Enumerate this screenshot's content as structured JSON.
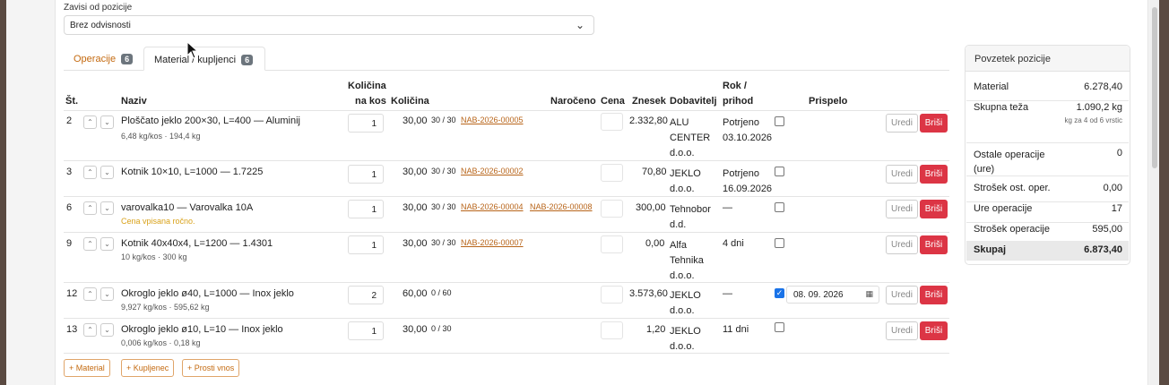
{
  "dependency": {
    "label": "Zavisi od pozicije",
    "value": "Brez odvisnosti"
  },
  "tabs": [
    {
      "label": "Operacije",
      "count": "6"
    },
    {
      "label": "Material / kupljenci",
      "count": "6"
    }
  ],
  "headers": {
    "st": "Št.",
    "naziv": "Naziv",
    "kol_na_kos_1": "Količina",
    "kol_na_kos_2": "na kos",
    "kolicina": "Količina",
    "naroceno": "Naročeno",
    "cena": "Cena",
    "znesek": "Znesek",
    "dobavitelj": "Dobavitelj",
    "rok_1": "Rok /",
    "rok_2": "prihod",
    "prispelo": "Prispelo"
  },
  "rows": [
    {
      "st": "2",
      "name": "Ploščato jeklo 200×30, L=400 — Aluminij",
      "sub": "6,48 kg/kos · 194,4 kg",
      "qty": "1",
      "kolicina": "30,00",
      "ordered": "30 / 30",
      "links": [
        "NAB-2026-00005"
      ],
      "znesek": "2.332,80",
      "dob": [
        "ALU",
        "CENTER",
        "d.o.o."
      ],
      "rok": [
        "Potrjeno",
        "03.10.2026"
      ],
      "checked": false
    },
    {
      "st": "3",
      "name": "Kotnik 10×10, L=1000 — 1.7225",
      "sub": "",
      "qty": "1",
      "kolicina": "30,00",
      "ordered": "30 / 30",
      "links": [
        "NAB-2026-00002"
      ],
      "znesek": "70,80",
      "dob": [
        "JEKLO",
        "d.o.o."
      ],
      "rok": [
        "Potrjeno",
        "16.09.2026"
      ],
      "checked": false
    },
    {
      "st": "6",
      "name": "varovalka10 — Varovalka 10A",
      "sub": "Cena vpisana ročno.",
      "qty": "1",
      "kolicina": "30,00",
      "ordered": "30 / 30",
      "links": [
        "NAB-2026-00004",
        "NAB-2026-00008"
      ],
      "znesek": "300,00",
      "dob": [
        "Tehnobor",
        "d.d."
      ],
      "rok": [
        "—"
      ],
      "checked": false
    },
    {
      "st": "9",
      "name": "Kotnik 40x40x4, L=1200 — 1.4301",
      "sub": "10 kg/kos · 300 kg",
      "qty": "1",
      "kolicina": "30,00",
      "ordered": "30 / 30",
      "links": [
        "NAB-2026-00007"
      ],
      "znesek": "0,00",
      "dob": [
        "Alfa",
        "Tehnika",
        "d.o.o."
      ],
      "rok": [
        "4 dni"
      ],
      "checked": false
    },
    {
      "st": "12",
      "name": "Okroglo jeklo ø40, L=1000 — Inox jeklo",
      "sub": "9,927 kg/kos · 595,62 kg",
      "qty": "2",
      "kolicina": "60,00",
      "ordered": "0 / 60",
      "links": [],
      "znesek": "3.573,60",
      "dob": [
        "JEKLO",
        "d.o.o."
      ],
      "rok": [
        "—"
      ],
      "checked": true,
      "date": "08. 09. 2026"
    },
    {
      "st": "13",
      "name": "Okroglo jeklo ø10, L=10 — Inox jeklo",
      "sub": "0,006 kg/kos · 0,18 kg",
      "qty": "1",
      "kolicina": "30,00",
      "ordered": "0 / 30",
      "links": [],
      "znesek": "1,20",
      "dob": [
        "JEKLO",
        "d.o.o."
      ],
      "rok": [
        "11 dni"
      ],
      "checked": false
    }
  ],
  "row_buttons": {
    "edit": "Uredi",
    "delete": "Briši"
  },
  "add_buttons": [
    "+ Material",
    "+ Kupljenec",
    "+ Prosti vnos"
  ],
  "summary": {
    "title": "Povzetek pozicije",
    "material": {
      "label": "Material",
      "value": "6.278,40"
    },
    "weight": {
      "label": "Skupna teža",
      "value": "1.090,2 kg",
      "note": "kg za 4 od 6 vrstic"
    },
    "other_ops": {
      "label": "Ostale operacije (ure)",
      "value": "0"
    },
    "other_cost": {
      "label": "Strošek ost. oper.",
      "value": "0,00"
    },
    "op_hours": {
      "label": "Ure operacije",
      "value": "17"
    },
    "op_cost": {
      "label": "Strošek operacije",
      "value": "595,00"
    },
    "total": {
      "label": "Skupaj",
      "value": "6.873,40"
    }
  }
}
